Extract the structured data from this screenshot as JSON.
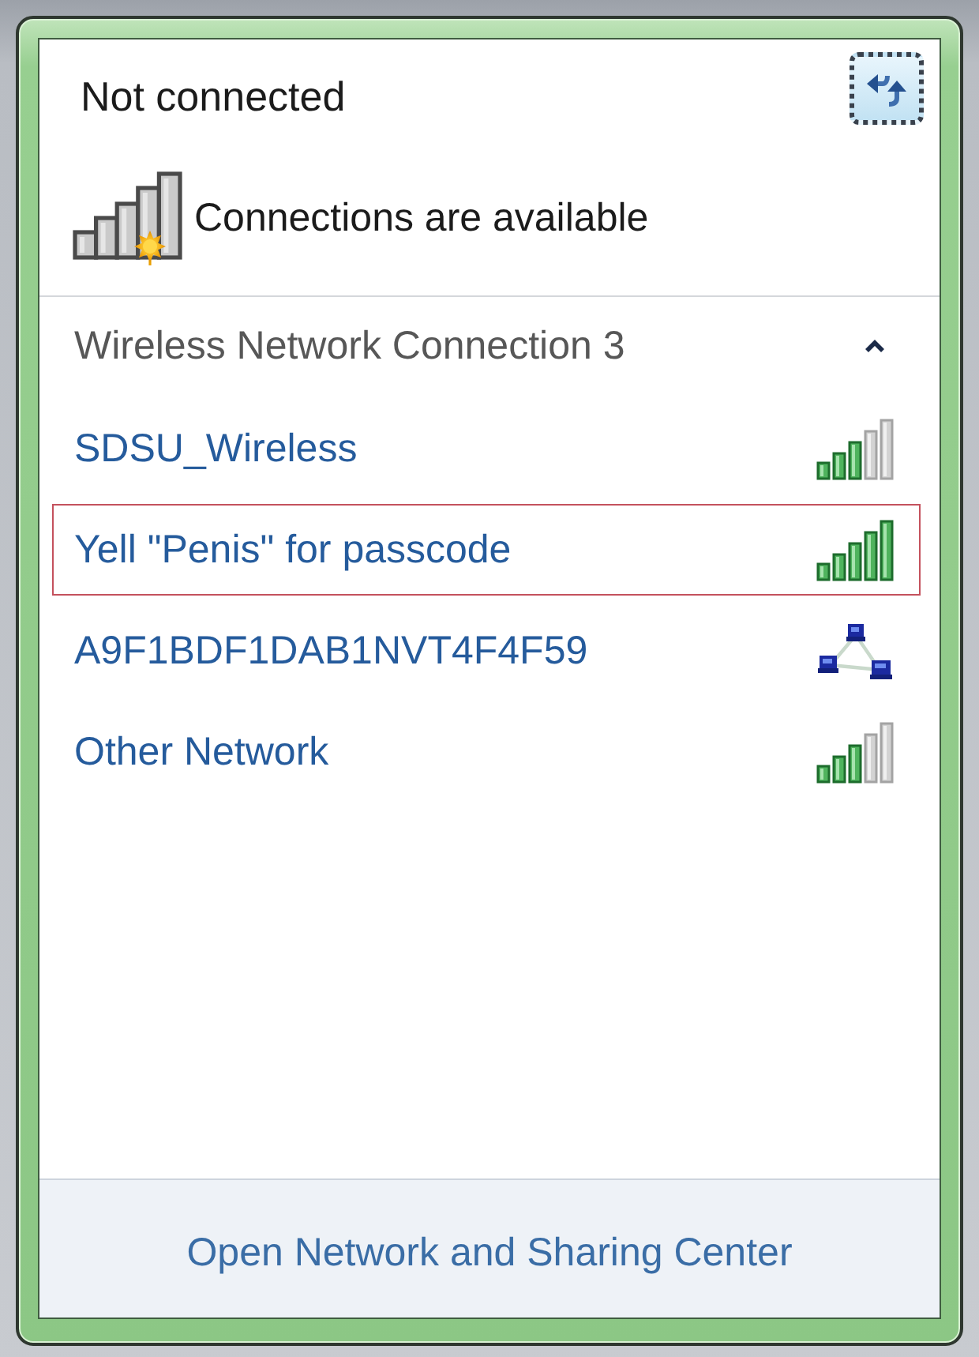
{
  "status": {
    "title": "Not connected",
    "subtitle": "Connections are available"
  },
  "connection_group": {
    "title": "Wireless Network Connection 3",
    "expanded": true,
    "networks": [
      {
        "name": "SDSU_Wireless",
        "kind": "good_signal",
        "selected": false
      },
      {
        "name": "Yell \"Penis\" for passcode",
        "kind": "excellent_signal",
        "selected": true
      },
      {
        "name": "A9F1BDF1DAB1NVT4F4F59",
        "kind": "ad_hoc",
        "selected": false
      },
      {
        "name": "Other Network",
        "kind": "good_signal",
        "selected": false
      }
    ]
  },
  "footer": {
    "link": "Open Network and Sharing Center"
  }
}
